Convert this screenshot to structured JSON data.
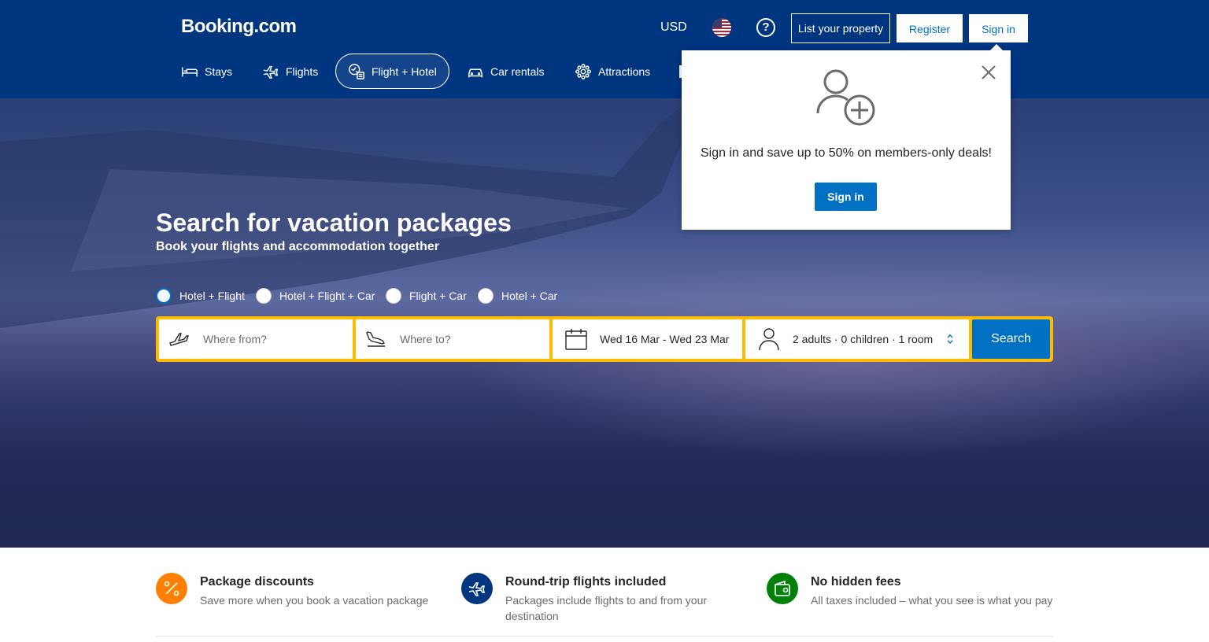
{
  "header": {
    "logo": "Booking.com",
    "currency": "USD",
    "list_property": "List your property",
    "register": "Register",
    "sign_in": "Sign in"
  },
  "nav": {
    "items": [
      {
        "label": "Stays",
        "icon": "bed-icon"
      },
      {
        "label": "Flights",
        "icon": "plane-icon"
      },
      {
        "label": "Flight + Hotel",
        "icon": "flight-hotel-icon",
        "active": true
      },
      {
        "label": "Car rentals",
        "icon": "car-icon"
      },
      {
        "label": "Attractions",
        "icon": "attractions-icon"
      }
    ]
  },
  "hero": {
    "title": "Search for vacation packages",
    "subtitle": "Book your flights and accommodation together"
  },
  "package_types": [
    {
      "label": "Hotel + Flight",
      "checked": true
    },
    {
      "label": "Hotel + Flight + Car",
      "checked": false
    },
    {
      "label": "Flight + Car",
      "checked": false
    },
    {
      "label": "Hotel + Car",
      "checked": false
    }
  ],
  "search": {
    "from_placeholder": "Where from?",
    "to_placeholder": "Where to?",
    "dates": "Wed 16 Mar - Wed 23 Mar",
    "guests": "2 adults · 0 children · 1 room",
    "button": "Search"
  },
  "popup": {
    "message": "Sign in and save up to 50% on members-only deals!",
    "button": "Sign in"
  },
  "benefits": [
    {
      "title": "Package discounts",
      "description": "Save more when you book a vacation package",
      "color": "#ff8000"
    },
    {
      "title": "Round-trip flights included",
      "description": "Packages include flights to and from your destination",
      "color": "#003580"
    },
    {
      "title": "No hidden fees",
      "description": "All taxes included – what you see is what you pay",
      "color": "#008009"
    }
  ],
  "colors": {
    "brand": "#003580",
    "accent": "#0071c2",
    "searchbar": "#febb02"
  }
}
